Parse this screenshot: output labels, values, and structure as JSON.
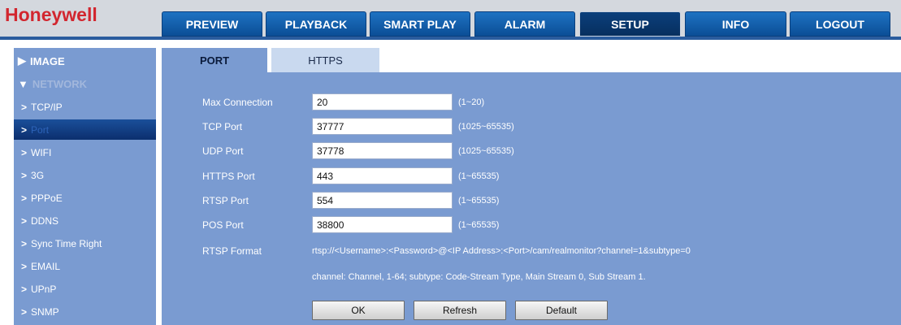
{
  "brand": {
    "logo_text": "Honeywell",
    "logo_color": "#d2262f"
  },
  "nav": {
    "items": [
      {
        "label": "PREVIEW"
      },
      {
        "label": "PLAYBACK"
      },
      {
        "label": "SMART PLAY"
      },
      {
        "label": "ALARM"
      },
      {
        "label": "SETUP",
        "active": true
      },
      {
        "label": "INFO"
      },
      {
        "label": "LOGOUT"
      }
    ]
  },
  "sidebar": {
    "image_section": "IMAGE",
    "network_section": "NETWORK",
    "items": [
      {
        "label": "TCP/IP"
      },
      {
        "label": "Port",
        "active": true
      },
      {
        "label": "WIFI"
      },
      {
        "label": "3G"
      },
      {
        "label": "PPPoE"
      },
      {
        "label": "DDNS"
      },
      {
        "label": "Sync Time Right"
      },
      {
        "label": "EMAIL"
      },
      {
        "label": "UPnP"
      },
      {
        "label": "SNMP"
      }
    ]
  },
  "tabs": {
    "port": "PORT",
    "https": "HTTPS"
  },
  "form": {
    "max_connection": {
      "label": "Max Connection",
      "value": "20",
      "hint": "(1~20)"
    },
    "tcp_port": {
      "label": "TCP Port",
      "value": "37777",
      "hint": "(1025~65535)"
    },
    "udp_port": {
      "label": "UDP Port",
      "value": "37778",
      "hint": "(1025~65535)"
    },
    "https_port": {
      "label": "HTTPS Port",
      "value": "443",
      "hint": "(1~65535)"
    },
    "rtsp_port": {
      "label": "RTSP Port",
      "value": "554",
      "hint": "(1~65535)"
    },
    "pos_port": {
      "label": "POS Port",
      "value": "38800",
      "hint": "(1~65535)"
    },
    "rtsp_format": {
      "label": "RTSP Format",
      "value": "rtsp://<Username>:<Password>@<IP Address>:<Port>/cam/realmonitor?channel=1&subtype=0",
      "note": "channel: Channel, 1-64; subtype: Code-Stream Type, Main Stream 0, Sub Stream 1."
    }
  },
  "buttons": {
    "ok": "OK",
    "refresh": "Refresh",
    "default": "Default"
  },
  "colors": {
    "accent": "#0b4e96",
    "panel": "#7a9bd1"
  }
}
